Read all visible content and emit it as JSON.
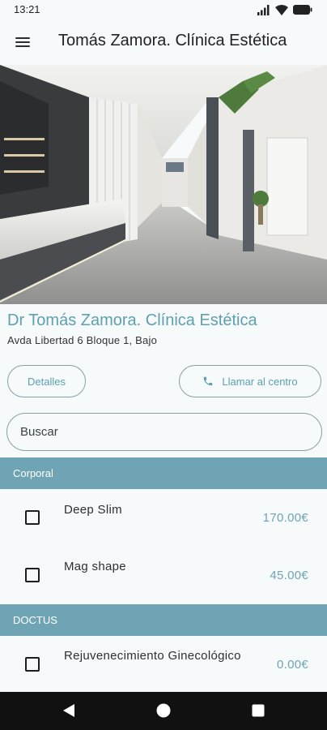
{
  "status_bar": {
    "time": "13:21"
  },
  "app_bar": {
    "title": "Tomás Zamora. Clínica Estética",
    "menu_icon": "menu-icon"
  },
  "clinic": {
    "name": "Dr Tomás Zamora. Clínica Estética",
    "address": "Avda Libertad 6 Bloque 1, Bajo"
  },
  "actions": {
    "details_label": "Detalles",
    "call_label": "Llamar al centro",
    "call_icon": "phone-icon"
  },
  "search": {
    "placeholder": "Buscar",
    "value": ""
  },
  "sections": [
    {
      "title": "Corporal",
      "items": [
        {
          "name": "Deep Slim",
          "price": "170.00€",
          "checked": false
        },
        {
          "name": "Mag shape",
          "price": "45.00€",
          "checked": false
        }
      ]
    },
    {
      "title": "DOCTUS",
      "items": [
        {
          "name": "Rejuvenecimiento Ginecológico",
          "price": "0.00€",
          "checked": false
        }
      ]
    }
  ],
  "colors": {
    "accent": "#5e9fb1",
    "section_header": "#6fa4b4",
    "background": "#f6fafb",
    "nav_bar": "#111111"
  }
}
